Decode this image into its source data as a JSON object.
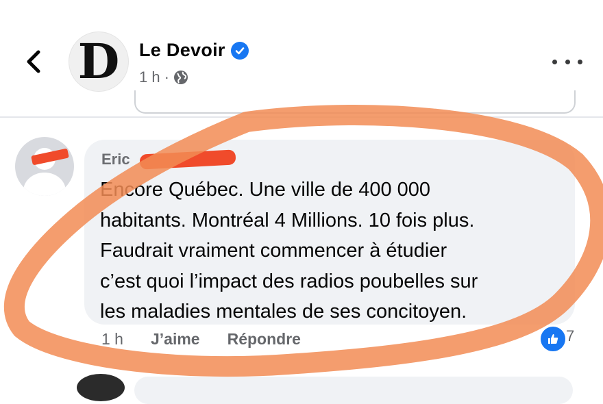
{
  "header": {
    "page_name": "Le Devoir",
    "page_logo": "D",
    "time": "1 h",
    "separator": "·",
    "icons": [
      "back-chevron-icon",
      "verified-badge-icon",
      "globe-icon",
      "more-options-icon"
    ]
  },
  "comment": {
    "author": "Eric",
    "lines": [
      "Encore Québec. Une ville de 400 000",
      "habitants.   Montréal 4 Millions. 10 fois plus.",
      "Faudrait vraiment commencer à étudier",
      "c’est quoi l’impact des radios poubelles sur",
      "les maladies mentales de ses concitoyen."
    ],
    "time": "1 h",
    "like_label": "J’aime",
    "reply_label": "Répondre",
    "reaction_count": "7"
  },
  "colors": {
    "accent": "#1877f2",
    "annotation": "#f28c55",
    "redaction": "#f04b2b"
  }
}
